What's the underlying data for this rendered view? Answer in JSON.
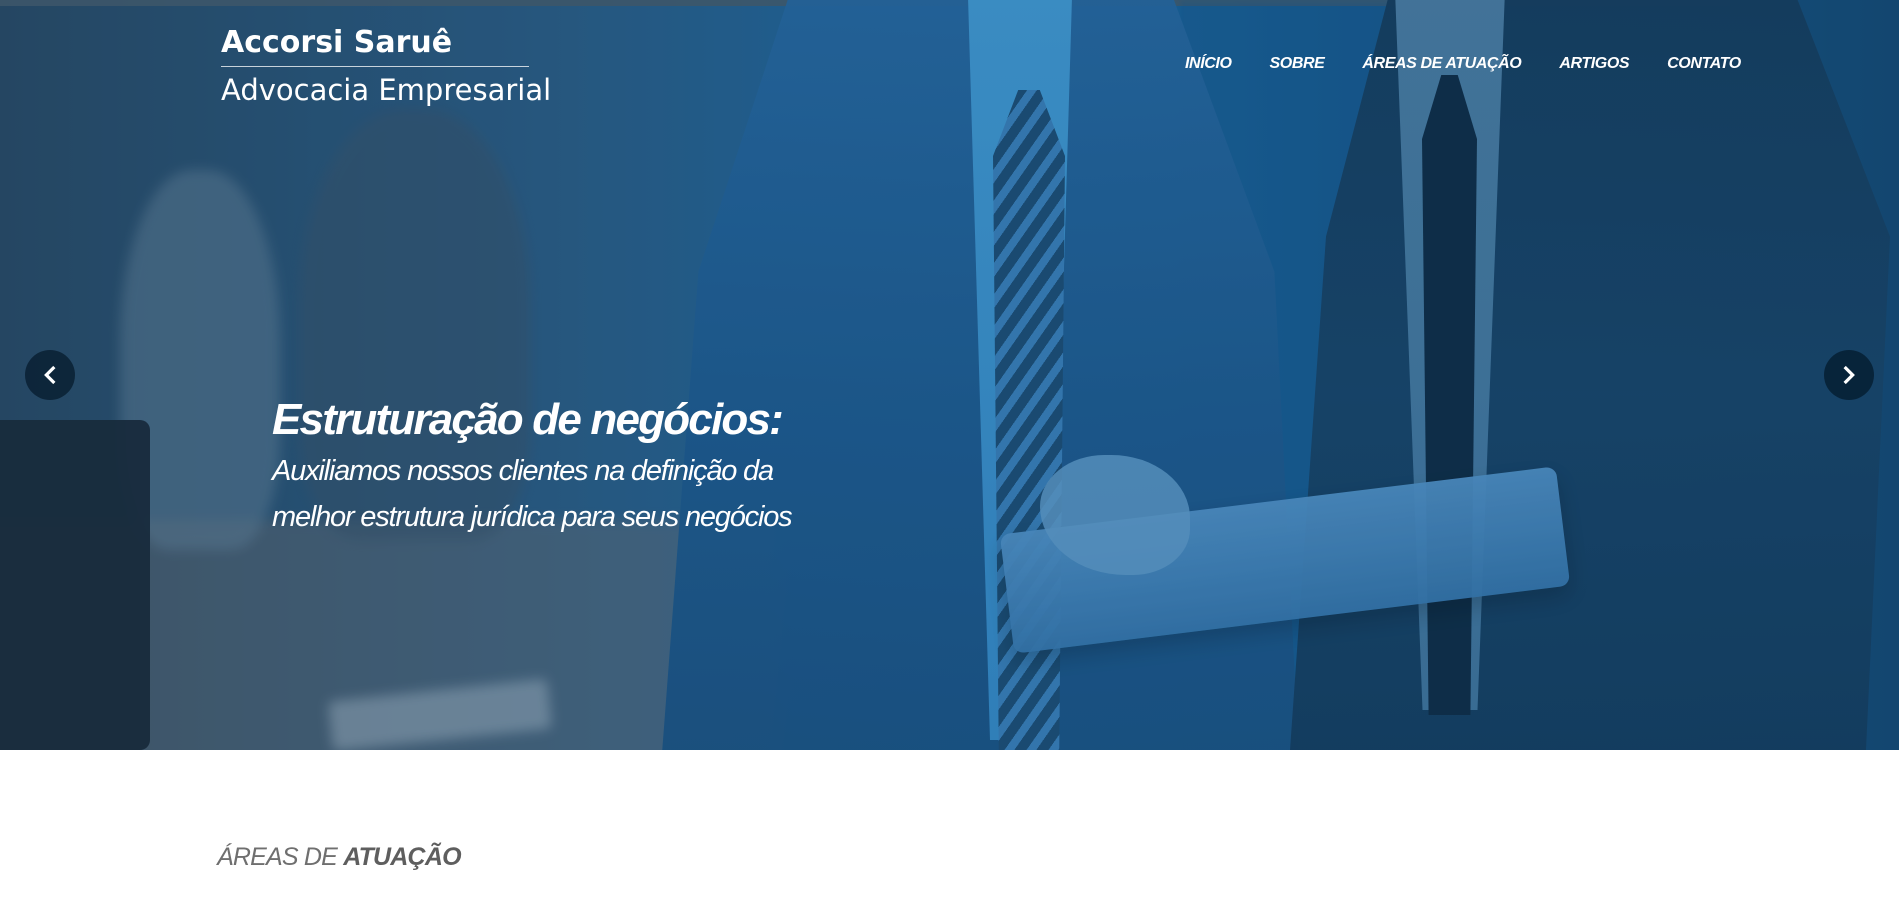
{
  "brand": {
    "name": "Accorsi Saruê",
    "tagline": "Advocacia Empresarial"
  },
  "nav": {
    "items": [
      "INÍCIO",
      "SOBRE",
      "ÁREAS DE ATUAÇÃO",
      "ARTIGOS",
      "CONTATO"
    ]
  },
  "hero": {
    "title": "Estruturação de negócios:",
    "text_line1": "Auxiliamos nossos clientes na definição da",
    "text_line2": "melhor estrutura jurídica para seus negócios",
    "prev_icon": "chevron-left-icon",
    "next_icon": "chevron-right-icon",
    "overlay_color": "#1d6aa5"
  },
  "section": {
    "heading_prefix": "ÁREAS DE",
    "heading_emphasis": "ATUAÇÃO"
  }
}
